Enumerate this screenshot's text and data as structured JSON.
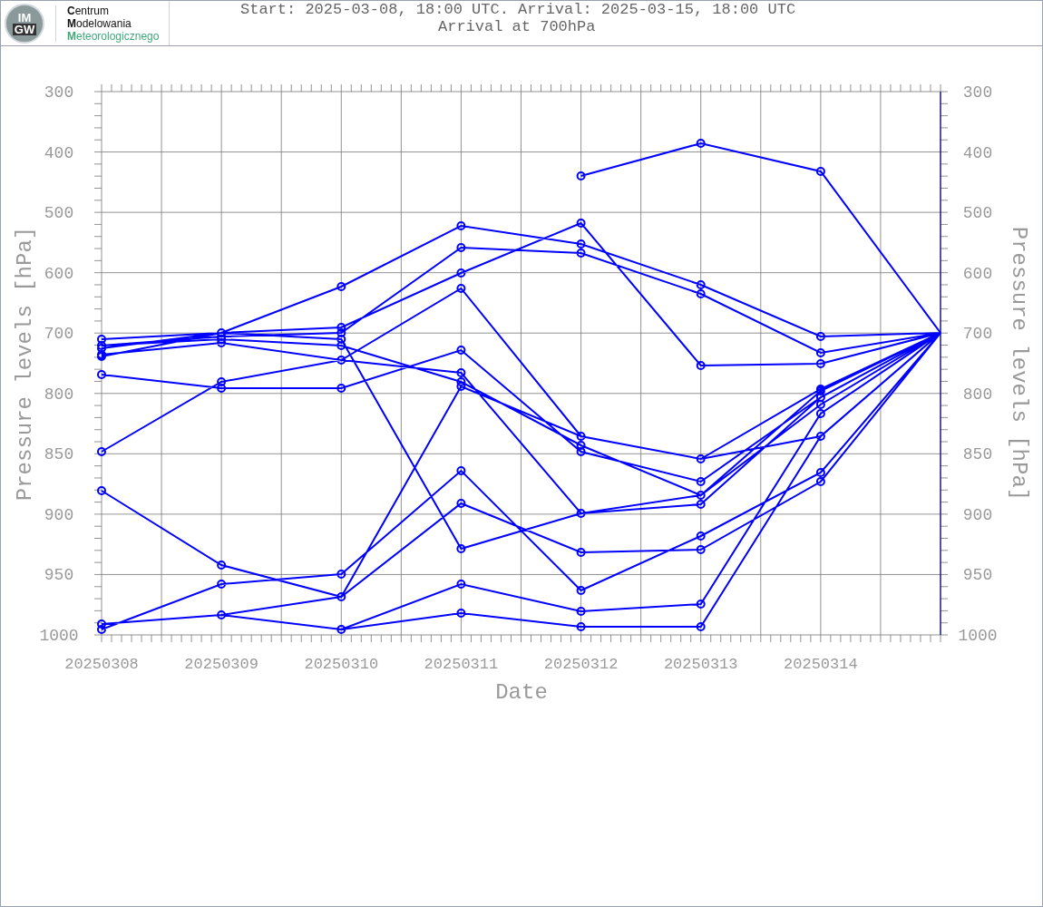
{
  "header": {
    "logo": {
      "badge": [
        "IM",
        "GW"
      ],
      "lines": [
        {
          "text": "**C**entrum",
          "color": "#111111"
        },
        {
          "text": "**M**odelowania",
          "color": "#111111"
        },
        {
          "text": "**M**eteorologicznego",
          "color": "#3fa87a"
        }
      ]
    },
    "title": [
      "Start: 2025-03-08, 18:00 UTC. Arrival: 2025-03-15, 18:00 UTC",
      "Arrival at 700hPa"
    ]
  },
  "plot": {
    "left_axis": {
      "label": "Pressure levels [hPa]",
      "ticks": [
        "300",
        "400",
        "500",
        "600",
        "700",
        "800",
        "850",
        "900",
        "950",
        "1000"
      ]
    },
    "right_axis": {
      "label": "Pressure levels [hPa]",
      "ticks": [
        "300",
        "400",
        "500",
        "600",
        "700",
        "800",
        "850",
        "900",
        "950",
        "1000"
      ]
    },
    "bottom_axis": {
      "label": "Date",
      "ticks": [
        "20250308",
        "20250309",
        "20250310",
        "20250311",
        "20250312",
        "20250313",
        "20250314"
      ]
    }
  }
}
